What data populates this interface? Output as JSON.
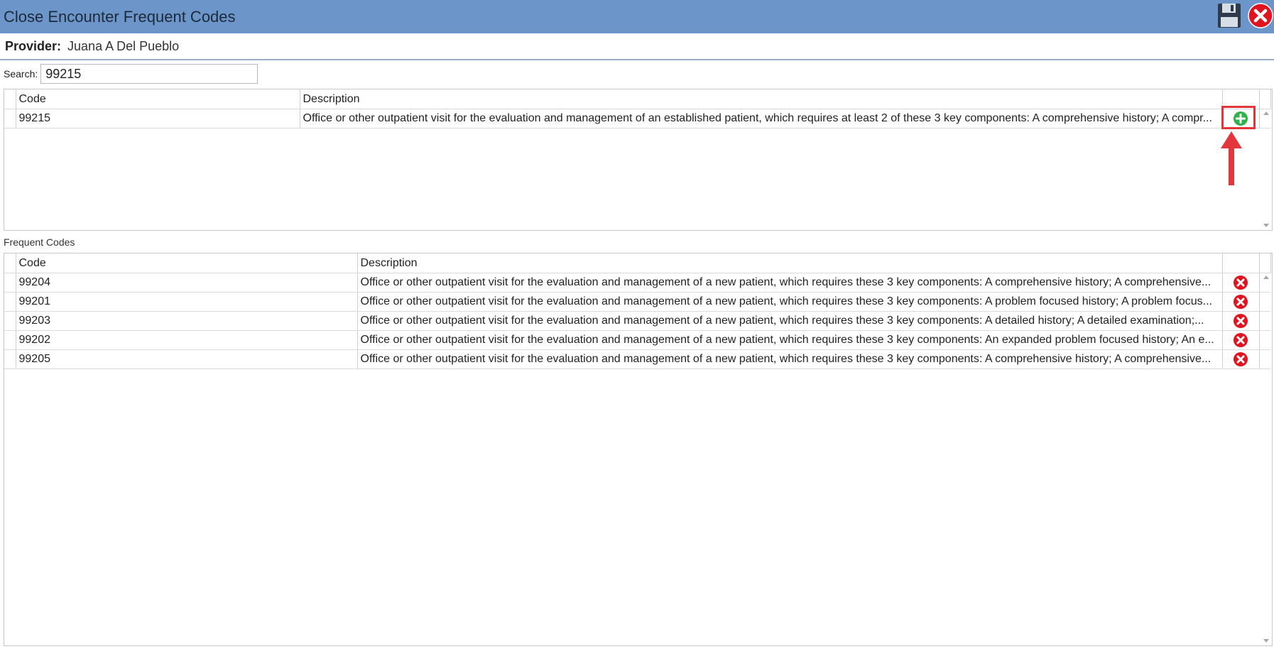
{
  "window": {
    "title": "Close Encounter Frequent Codes",
    "save_icon": "save-icon",
    "close_icon": "close-icon"
  },
  "provider": {
    "label": "Provider:",
    "name": "Juana A Del Pueblo"
  },
  "search": {
    "label": "Search:",
    "value": "99215"
  },
  "results": {
    "columns": [
      "Code",
      "Description"
    ],
    "rows": [
      {
        "code": "99215",
        "description": "Office or other outpatient visit for the evaluation and management of an established patient, which requires at least 2 of these 3 key components: A comprehensive history; A compr...",
        "action_icon": "add-icon"
      }
    ]
  },
  "frequent_codes": {
    "label": "Frequent Codes",
    "columns": [
      "Code",
      "Description"
    ],
    "rows": [
      {
        "code": "99204",
        "description": "Office or other outpatient visit for the evaluation and management of a new patient, which requires these 3 key components: A comprehensive history; A comprehensive...",
        "action_icon": "remove-icon"
      },
      {
        "code": "99201",
        "description": "Office or other outpatient visit for the evaluation and management of a new patient, which requires these 3 key components: A problem focused history; A problem focus...",
        "action_icon": "remove-icon"
      },
      {
        "code": "99203",
        "description": "Office or other outpatient visit for the evaluation and management of a new patient, which requires these 3 key components: A detailed history; A detailed examination;...",
        "action_icon": "remove-icon"
      },
      {
        "code": "99202",
        "description": "Office or other outpatient visit for the evaluation and management of a new patient, which requires these 3 key components: An expanded problem focused history; An e...",
        "action_icon": "remove-icon"
      },
      {
        "code": "99205",
        "description": "Office or other outpatient visit for the evaluation and management of a new patient, which requires these 3 key components: A comprehensive history; A comprehensive...",
        "action_icon": "remove-icon"
      }
    ]
  },
  "colors": {
    "titlebar": "#6c96c9",
    "add": "#2db34a",
    "remove": "#e0141e",
    "annotation": "#e2353c"
  }
}
